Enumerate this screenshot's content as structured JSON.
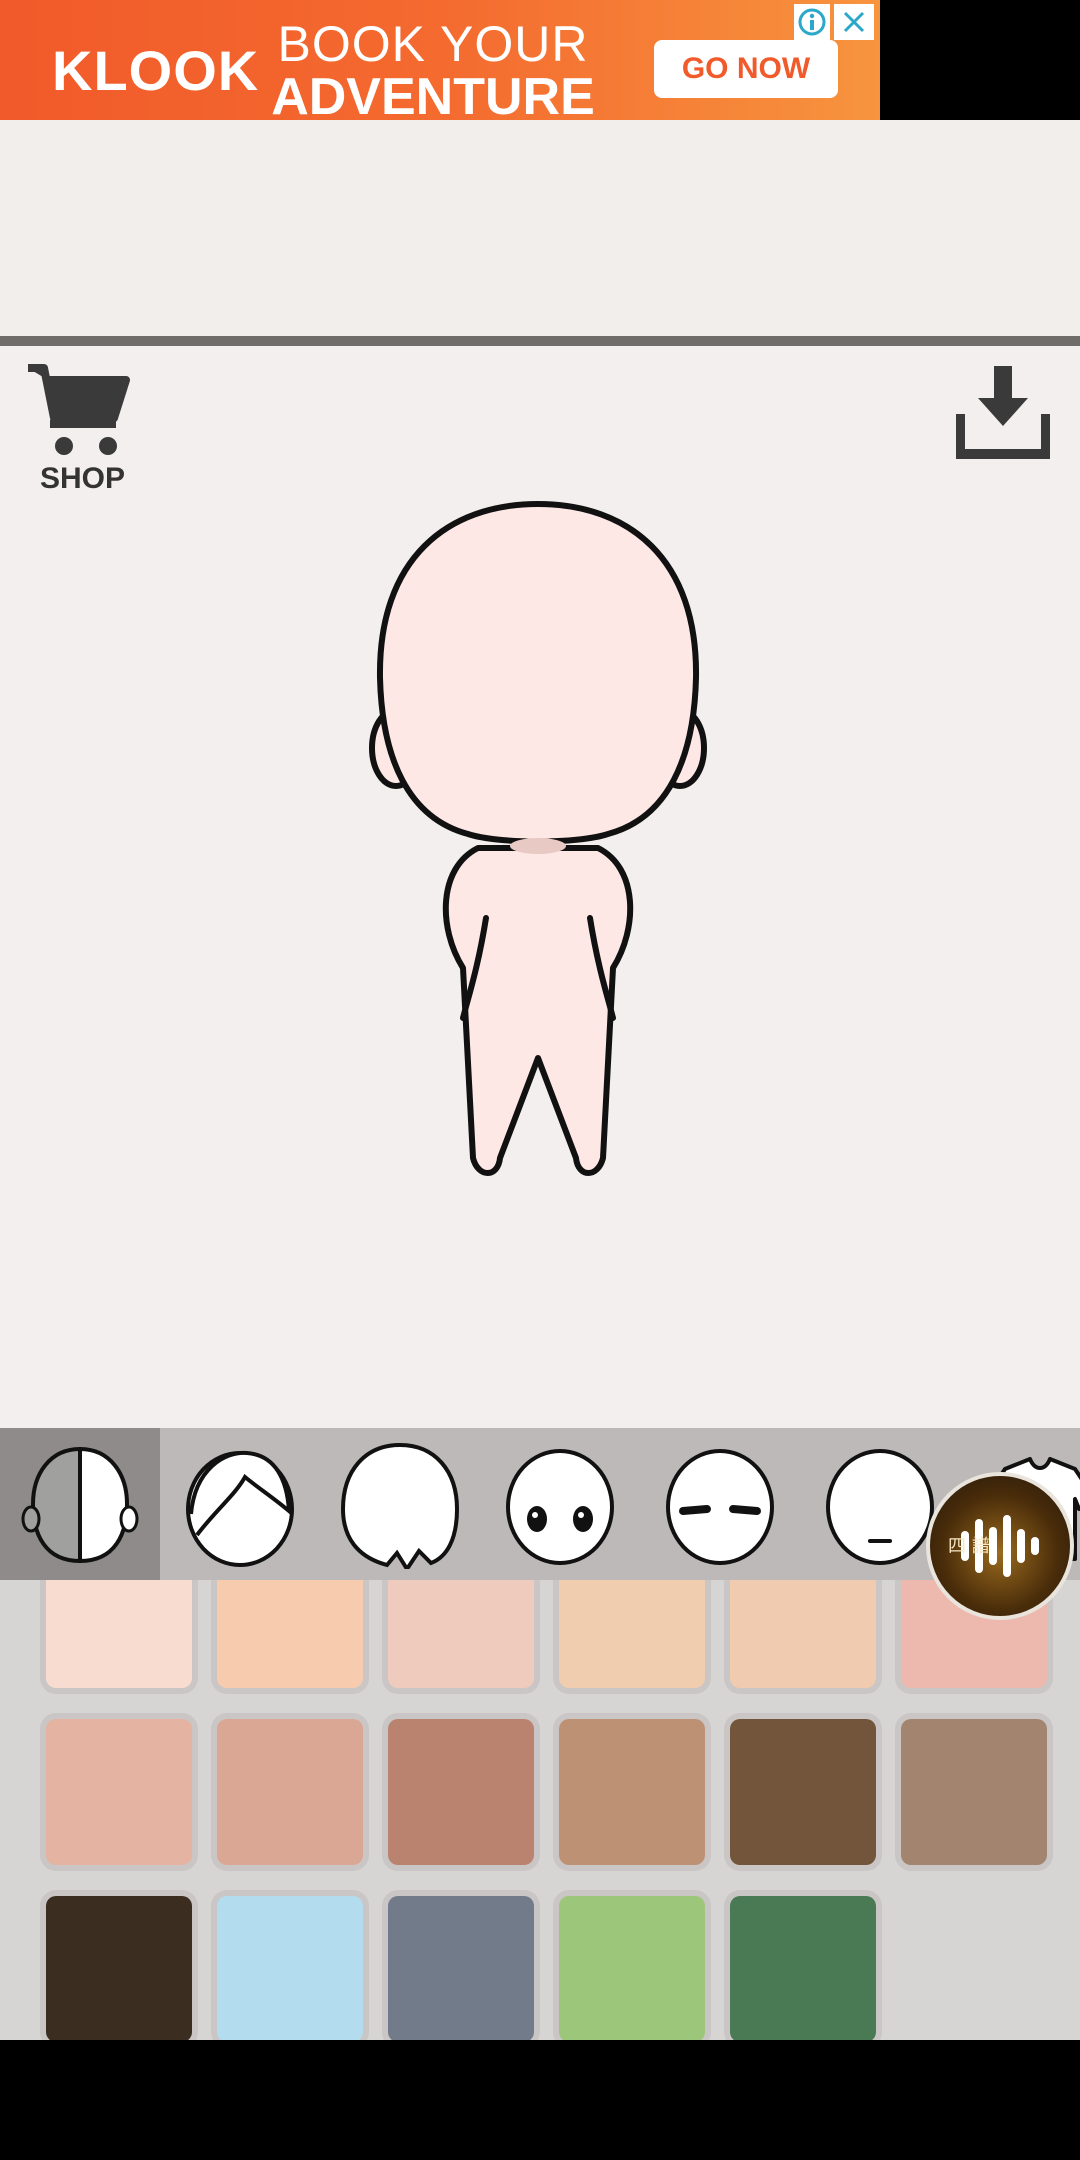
{
  "ad": {
    "brand": "KLOOK",
    "headline_1": "BOOK YOUR",
    "headline_2": "ADVENTURE",
    "cta": "GO NOW",
    "info_icon": "info-icon",
    "close_icon": "close-icon"
  },
  "toolbar": {
    "shop_label": "SHOP",
    "shop_icon": "cart-icon",
    "download_icon": "download-icon"
  },
  "categories": [
    {
      "name": "skin-color",
      "selected": true
    },
    {
      "name": "back-hair"
    },
    {
      "name": "front-hair"
    },
    {
      "name": "eyes"
    },
    {
      "name": "eyebrows"
    },
    {
      "name": "mouth"
    },
    {
      "name": "clothes"
    }
  ],
  "swatches": [
    "#f8dcd0",
    "#f7cbae",
    "#efcbbd",
    "#f1cdb0",
    "#f0cbb0",
    "#edb9ae",
    "#e5b3a2",
    "#dba795",
    "#b98370",
    "#bd9173",
    "#72553b",
    "#a3856f",
    "#3c2d21",
    "#b3dcee",
    "#717b8a",
    "#9cc67a",
    "#4a7a54"
  ],
  "floating": {
    "music_text": "四 譜"
  }
}
